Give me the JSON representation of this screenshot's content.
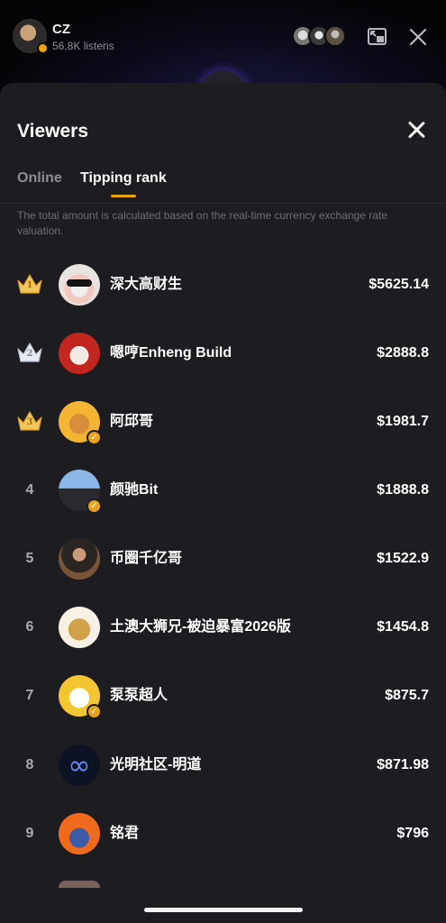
{
  "header": {
    "host_name": "CZ",
    "host_listens": "56.8K listens"
  },
  "sheet": {
    "title": "Viewers",
    "tabs": [
      {
        "label": "Online",
        "active": false
      },
      {
        "label": "Tipping rank",
        "active": true
      }
    ],
    "note": "The total amount is calculated based on the real-time currency exchange rate valuation."
  },
  "ranking": [
    {
      "rank": "1",
      "name": "深大高财生",
      "amount": "$5625.14",
      "crown": "gold",
      "verified": false
    },
    {
      "rank": "2",
      "name": "嗯哼Enheng Build",
      "amount": "$2888.8",
      "crown": "silver",
      "verified": false
    },
    {
      "rank": "3",
      "name": "阿邱哥",
      "amount": "$1981.7",
      "crown": "gold",
      "verified": true
    },
    {
      "rank": "4",
      "name": "颜驰Bit",
      "amount": "$1888.8",
      "crown": "",
      "verified": true
    },
    {
      "rank": "5",
      "name": "币圈千亿哥",
      "amount": "$1522.9",
      "crown": "",
      "verified": false
    },
    {
      "rank": "6",
      "name": "土澳大狮兄-被迫暴富2026版",
      "amount": "$1454.8",
      "crown": "",
      "verified": false
    },
    {
      "rank": "7",
      "name": "泵泵超人",
      "amount": "$875.7",
      "crown": "",
      "verified": true
    },
    {
      "rank": "8",
      "name": "光明社区-明道",
      "amount": "$871.98",
      "crown": "",
      "verified": false
    },
    {
      "rank": "9",
      "name": "铭君",
      "amount": "$796",
      "crown": "",
      "verified": false
    }
  ],
  "colors": {
    "accent": "#e9a317",
    "sheet_bg": "#1d1d21",
    "muted_text": "#8d8d96"
  },
  "icons": {
    "minimize": "picture-in-picture-icon",
    "close": "close-icon",
    "crown": "crown-icon",
    "verified": "verified-badge-icon"
  }
}
